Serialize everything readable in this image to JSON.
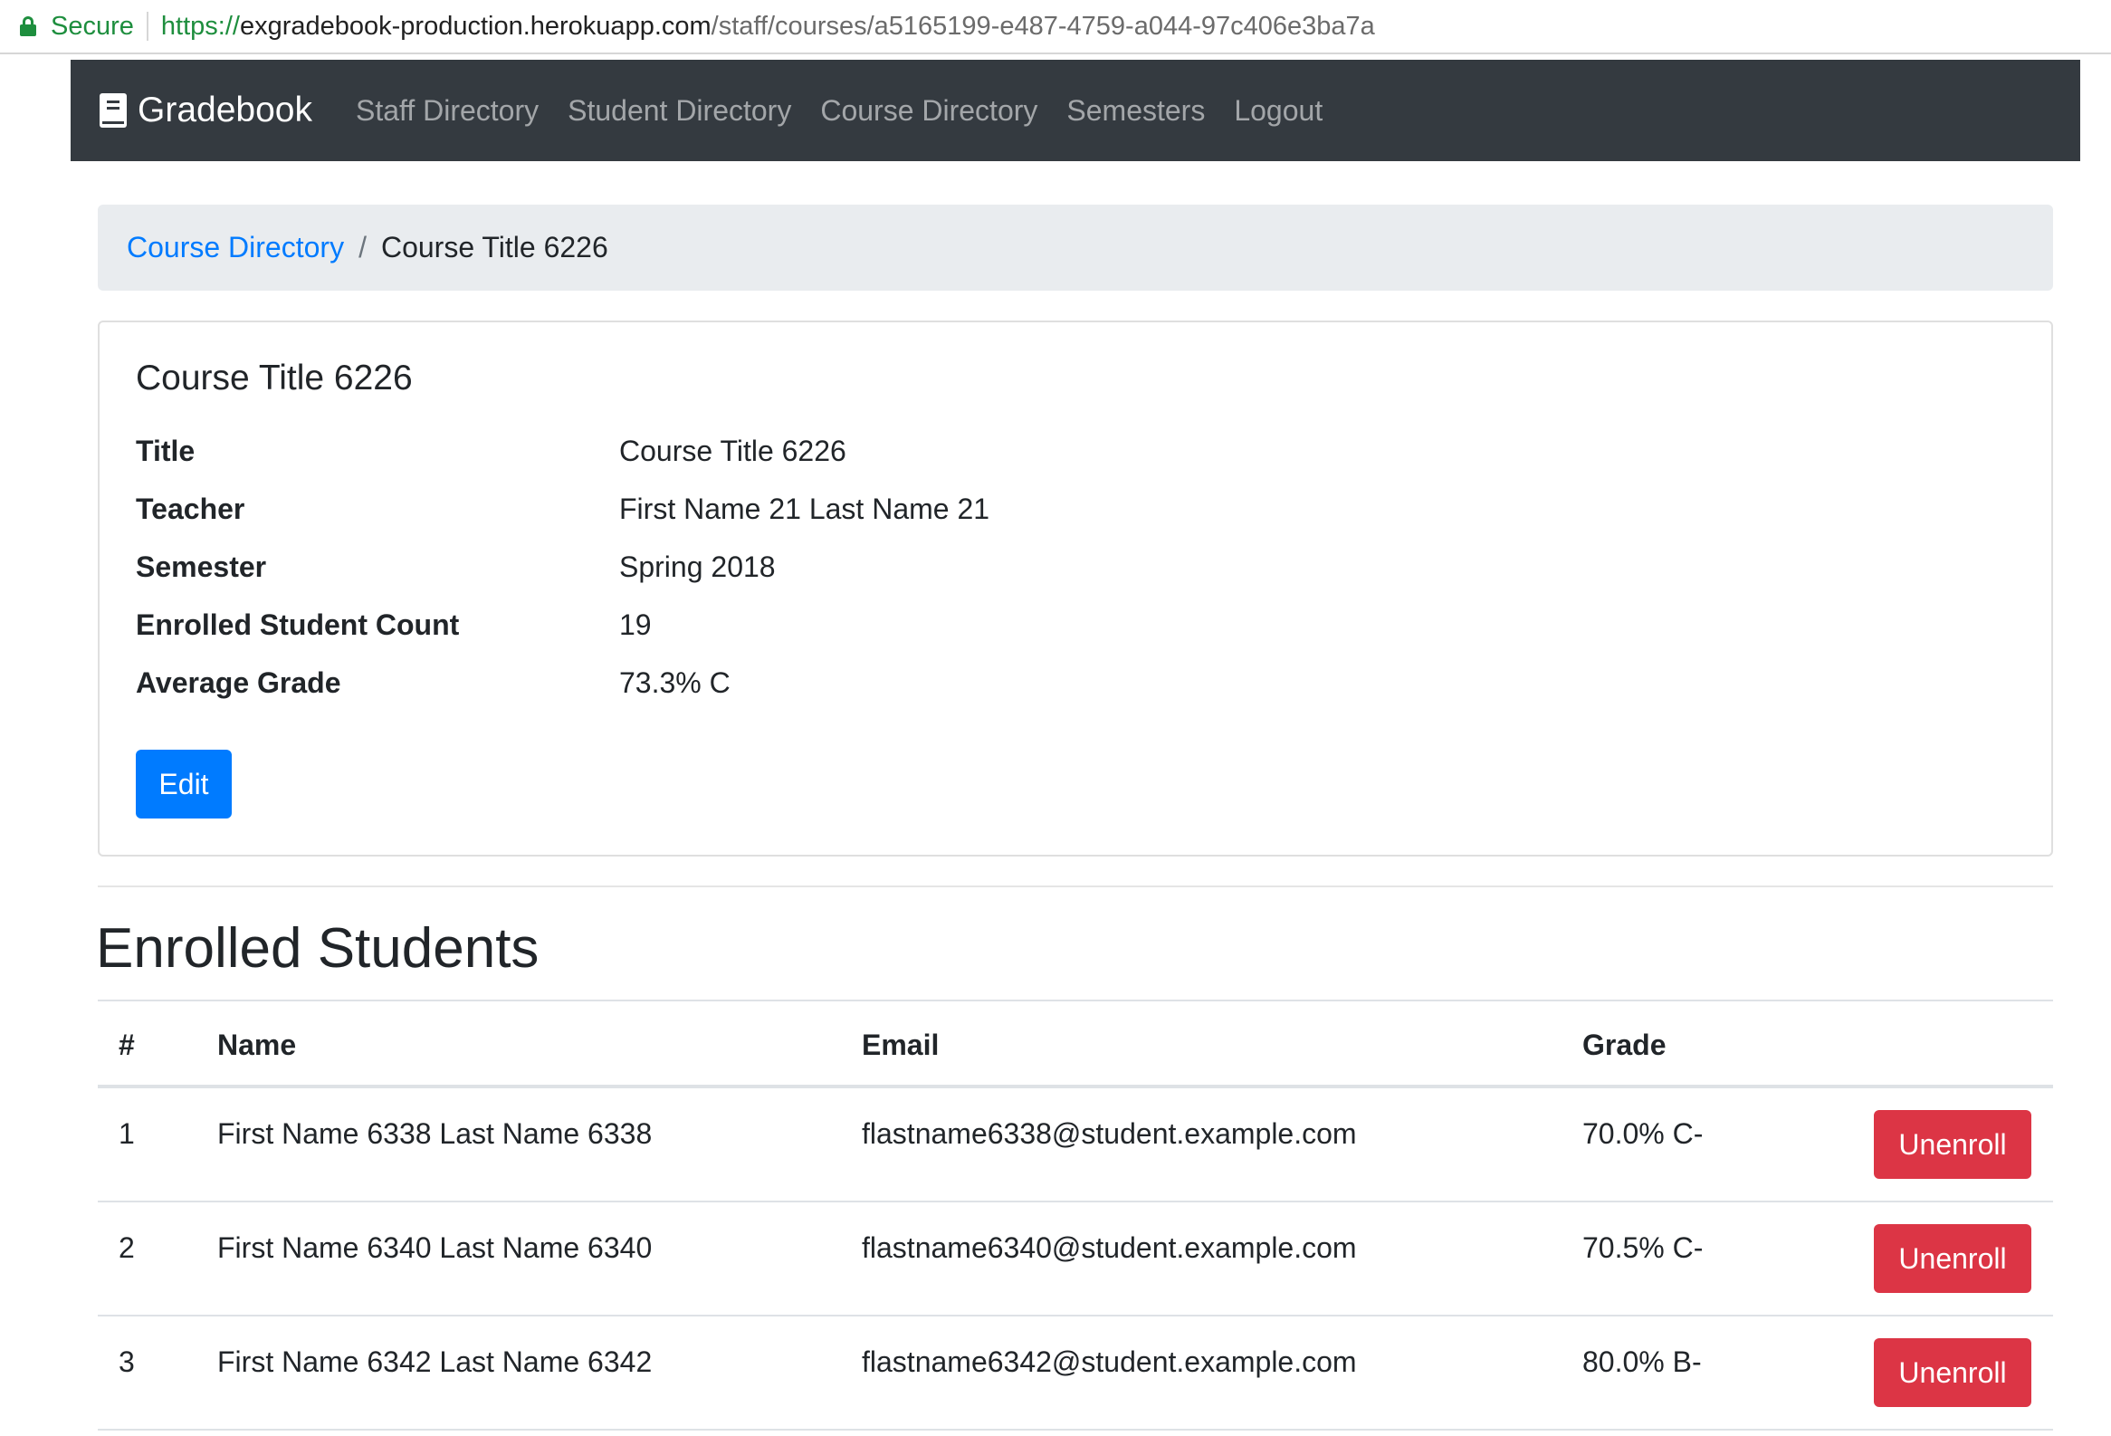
{
  "browser": {
    "secure_label": "Secure",
    "url_scheme": "https://",
    "url_host": "exgradebook-production.herokuapp.com",
    "url_path": "/staff/courses/a5165199-e487-4759-a044-97c406e3ba7a"
  },
  "navbar": {
    "brand": "Gradebook",
    "links": [
      "Staff Directory",
      "Student Directory",
      "Course Directory",
      "Semesters",
      "Logout"
    ]
  },
  "breadcrumb": {
    "parent": "Course Directory",
    "separator": "/",
    "current": "Course Title 6226"
  },
  "course": {
    "heading": "Course Title 6226",
    "details": [
      {
        "label": "Title",
        "value": "Course Title 6226"
      },
      {
        "label": "Teacher",
        "value": "First Name 21 Last Name 21"
      },
      {
        "label": "Semester",
        "value": "Spring 2018"
      },
      {
        "label": "Enrolled Student Count",
        "value": "19"
      },
      {
        "label": "Average Grade",
        "value": "73.3% C"
      }
    ],
    "edit_label": "Edit"
  },
  "enrolled": {
    "title": "Enrolled Students",
    "columns": [
      "#",
      "Name",
      "Email",
      "Grade"
    ],
    "rows": [
      {
        "num": "1",
        "name": "First Name 6338 Last Name 6338",
        "email": "flastname6338@student.example.com",
        "grade": "70.0% C-",
        "action": "Unenroll"
      },
      {
        "num": "2",
        "name": "First Name 6340 Last Name 6340",
        "email": "flastname6340@student.example.com",
        "grade": "70.5% C-",
        "action": "Unenroll"
      },
      {
        "num": "3",
        "name": "First Name 6342 Last Name 6342",
        "email": "flastname6342@student.example.com",
        "grade": "80.0% B-",
        "action": "Unenroll"
      }
    ]
  },
  "colors": {
    "navbar_bg": "#343a40",
    "primary": "#007bff",
    "danger": "#dc3545",
    "secure_green": "#1e8e3e",
    "breadcrumb_bg": "#e9ecef"
  }
}
